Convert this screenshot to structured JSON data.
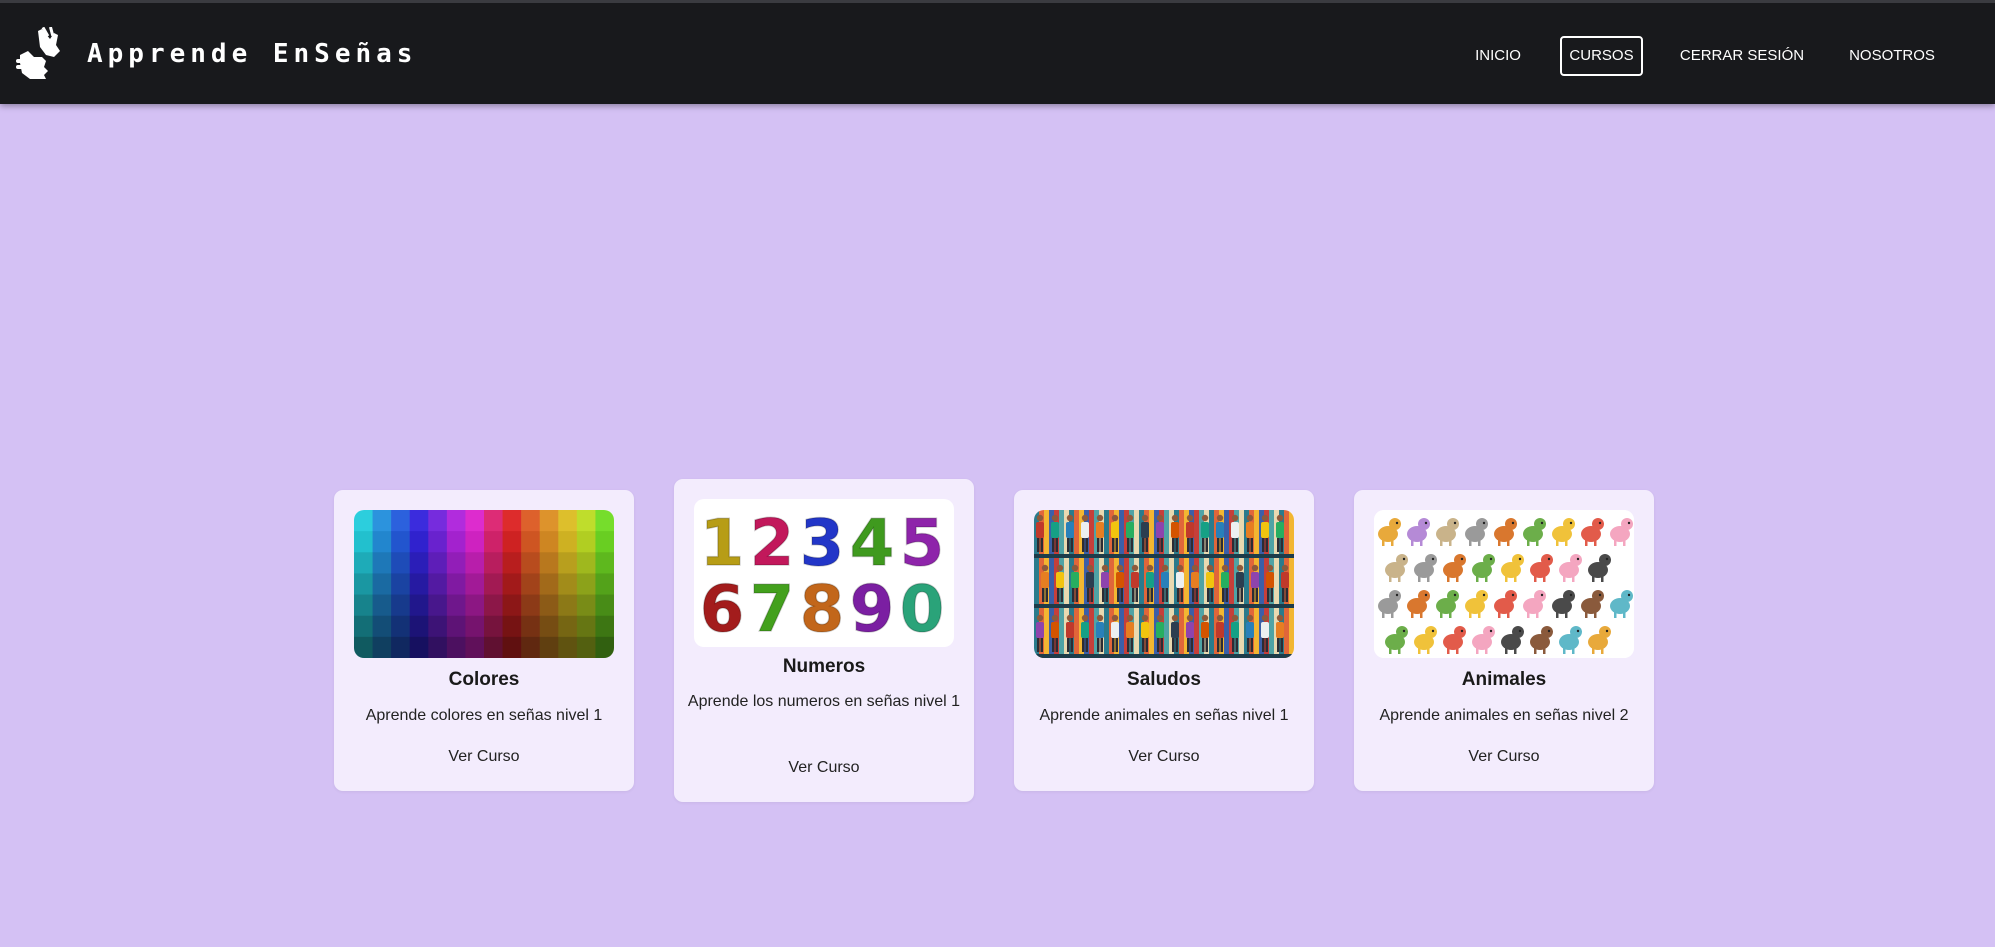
{
  "header": {
    "brand_name": "Apprende EnSeñas",
    "logo_icon": "hand-sign-icon",
    "nav": [
      {
        "label": "INICIO",
        "active": false
      },
      {
        "label": "CURSOS",
        "active": true
      },
      {
        "label": "CERRAR SESIÓN",
        "active": false
      },
      {
        "label": "NOSOTROS",
        "active": false
      }
    ]
  },
  "courses": [
    {
      "title": "Colores",
      "description": "Aprende colores en señas nivel 1",
      "link": "Ver Curso",
      "image": "color-palette-grid"
    },
    {
      "title": "Numeros",
      "description": "Aprende los numeros en señas nivel 1",
      "link": "Ver Curso",
      "image": "colorful-numbers"
    },
    {
      "title": "Saludos",
      "description": "Aprende animales en señas nivel 1",
      "link": "Ver Curso",
      "image": "people-greeting-crowd"
    },
    {
      "title": "Animales",
      "description": "Aprende animales en señas nivel 2",
      "link": "Ver Curso",
      "image": "cartoon-animals"
    }
  ],
  "image_numbers": {
    "row1": [
      "1",
      "2",
      "3",
      "4",
      "5"
    ],
    "row2": [
      "6",
      "7",
      "8",
      "9",
      "0"
    ]
  },
  "colors": {
    "page_background": "#d4c1f4",
    "header_background": "#18191c",
    "card_background": "#f3ecfd"
  }
}
